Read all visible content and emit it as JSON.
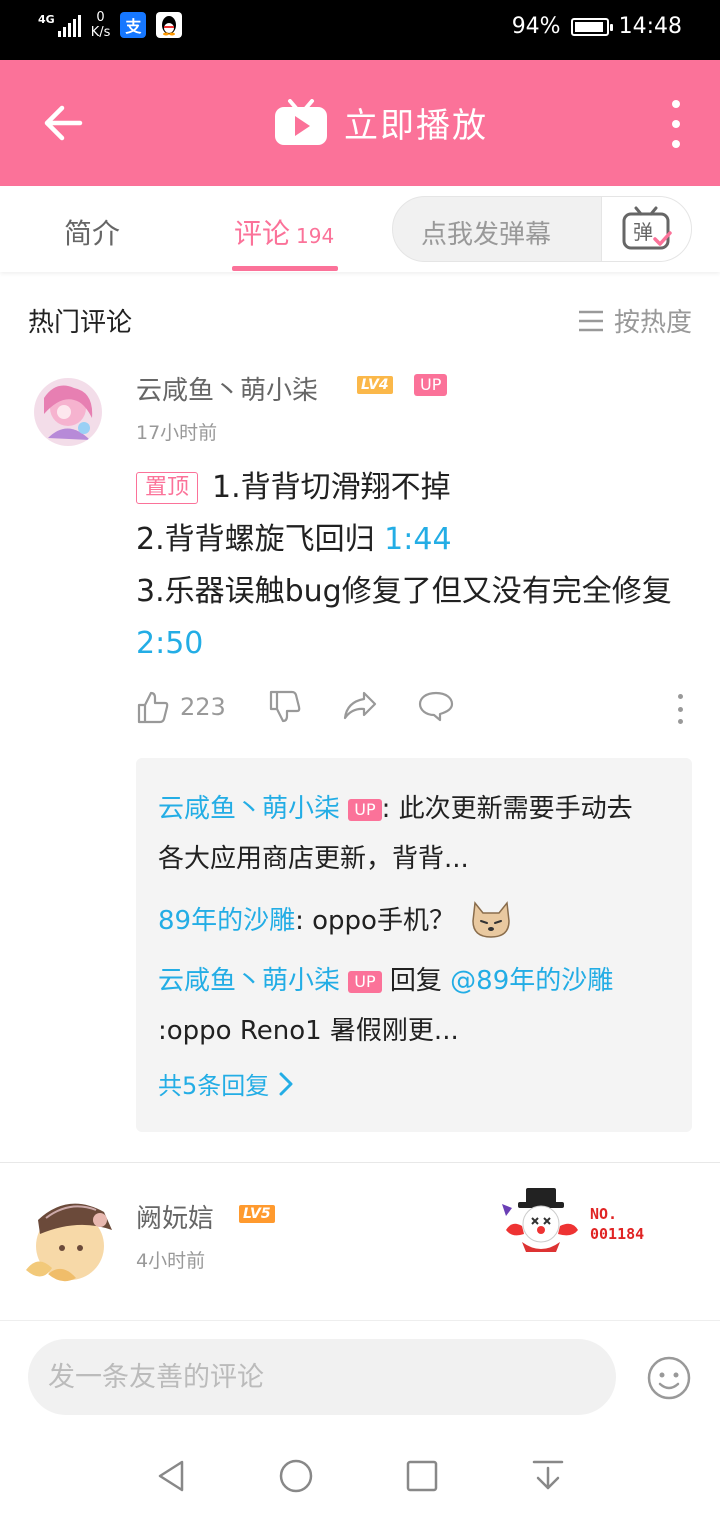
{
  "status_bar": {
    "network": "4G",
    "net_speed_value": "0",
    "net_speed_unit": "K/s",
    "battery_percent": "94%",
    "battery_level": 0.94,
    "time": "14:48"
  },
  "header": {
    "title": "立即播放"
  },
  "tabs": {
    "intro": "简介",
    "comments": "评论",
    "comments_count": "194",
    "danmaku_placeholder": "点我发弹幕",
    "danmaku_icon_text": "弹"
  },
  "section": {
    "hot_title": "热门评论",
    "sort_label": "按热度"
  },
  "comment1": {
    "username": "云咸鱼丶萌小柒",
    "level": "LV4",
    "up_badge": "UP",
    "time": "17小时前",
    "pin_label": "置顶",
    "line1": "1.背背切滑翔不掉",
    "line2_text": "2.背背螺旋飞回归 ",
    "line2_ts": "1:44",
    "line3": "3.乐器误触bug修复了但又没有完全修复 ",
    "line3_ts": "2:50",
    "likes": "223",
    "replies": {
      "r1_name": "云咸鱼丶萌小柒",
      "r1_badge": "UP",
      "r1_text": ": 此次更新需要手动去各大应用商店更新，背背...",
      "r2_name": "89年的沙雕",
      "r2_text": ": oppo手机？",
      "r3_name": "云咸鱼丶萌小柒",
      "r3_badge": "UP",
      "r3_reply_word": " 回复 ",
      "r3_mention": "@89年的沙雕",
      "r3_text": " :oppo Reno1 暑假刚更...",
      "more": "共5条回复"
    }
  },
  "comment2": {
    "username": "阙妧娮",
    "level": "LV5",
    "time": "4小时前",
    "badge_no": "NO.",
    "badge_num": "001184"
  },
  "bottom_bar": {
    "placeholder": "发一条友善的评论"
  },
  "colors": {
    "brand_pink": "#fb7299",
    "link_blue": "#23ade5"
  }
}
